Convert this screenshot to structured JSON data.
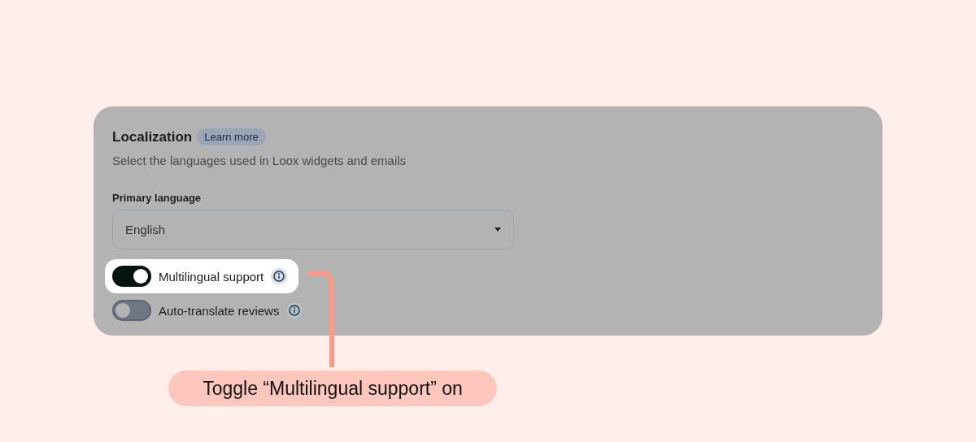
{
  "section": {
    "title": "Localization",
    "learn_more": "Learn more",
    "description": "Select the languages used in Loox widgets and emails"
  },
  "primary_language": {
    "label": "Primary language",
    "value": "English"
  },
  "settings": [
    {
      "kind": "toggle",
      "label": "Multilingual support",
      "on": true,
      "highlighted": true
    },
    {
      "kind": "toggle",
      "label": "Auto-translate reviews",
      "on": false,
      "highlighted": false
    }
  ],
  "callout": {
    "text": "Toggle “Multilingual support” on"
  }
}
